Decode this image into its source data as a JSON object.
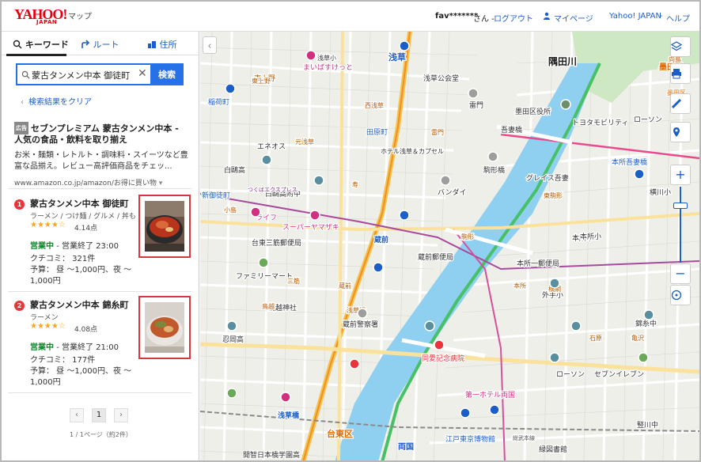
{
  "header": {
    "logo": "YAHOO!",
    "logo_sub": "JAPAN",
    "service": "マップ",
    "user": "fav*******",
    "user_suffix": "さん -",
    "logout": "ログアウト",
    "mypage": "マイページ",
    "yahoo_japan": "Yahoo! JAPAN",
    "help": "ヘルプ"
  },
  "tabs": [
    {
      "label": "キーワード",
      "icon": "search-icon"
    },
    {
      "label": "ルート",
      "icon": "route-arrow-icon"
    },
    {
      "label": "住所",
      "icon": "address-icon"
    }
  ],
  "search": {
    "value": "蒙古タンメン中本 御徒町",
    "button": "検索"
  },
  "back_link": "検索結果をクリア",
  "ad": {
    "badge": "広告",
    "title": "セブンプレミアム 蒙古タンメン中本 - 人気の食品・飲料を取り揃え",
    "desc": "お米・麺類・レトルト・調味料・スイーツなど豊富な品揃え。レビュー高評価商品をチェッ...",
    "url": "www.amazon.co.jp/amazon/お得に買い物"
  },
  "results": [
    {
      "num": "1",
      "name": "蒙古タンメン中本 御徒町",
      "category": "ラーメン / つけ麺 / グルメ / 丼も…",
      "stars": "★★★★☆",
      "score": "4.14点",
      "status_open": "営業中",
      "status_rest": "- 営業終了 23:00",
      "review": "クチコミ： 321件",
      "budget": "予算： 昼 〜1,000円、夜 〜1,000円"
    },
    {
      "num": "2",
      "name": "蒙古タンメン中本 錦糸町",
      "category": "ラーメン",
      "stars": "★★★★☆",
      "score": "4.08点",
      "status_open": "営業中",
      "status_rest": "- 営業終了 21:00",
      "review": "クチコミ： 177件",
      "budget": "予算： 昼 〜1,000円、夜 〜1,000円"
    }
  ],
  "pager": {
    "prev": "‹",
    "current": "1",
    "next": "›",
    "info": "1 / 1ページ（約2件）"
  },
  "map": {
    "labels": [
      {
        "t": "浅草",
        "c": "#1c5ec8"
      },
      {
        "t": "隅田川",
        "c": "#1a1a1a"
      },
      {
        "t": "墨田区",
        "c": "#e06a00"
      },
      {
        "t": "まいばすけっと",
        "c": "#d12f80"
      },
      {
        "t": "東上野",
        "c": "#b85a00"
      },
      {
        "t": "稲荷町",
        "c": "#1c5ec8"
      },
      {
        "t": "浅草公会堂",
        "c": "#333"
      },
      {
        "t": "雷門",
        "c": "#333"
      },
      {
        "t": "墨田区役所",
        "c": "#333"
      },
      {
        "t": "トヨタモビリティ",
        "c": "#333"
      },
      {
        "t": "吾妻橋",
        "c": "#333"
      },
      {
        "t": "田原町",
        "c": "#1c5ec8"
      },
      {
        "t": "エネオス",
        "c": "#333"
      },
      {
        "t": "ホテル浅草＆カプセル",
        "c": "#333"
      },
      {
        "t": "白鷗高",
        "c": "#333"
      },
      {
        "t": "白鷗高附中",
        "c": "#333"
      },
      {
        "t": "バンダイ",
        "c": "#333"
      },
      {
        "t": "駒形橋",
        "c": "#333"
      },
      {
        "t": "グレイス吾妻",
        "c": "#333"
      },
      {
        "t": "本所吾妻橋",
        "c": "#1c5ec8"
      },
      {
        "t": "新御徒町",
        "c": "#1c5ec8"
      },
      {
        "t": "ライフ",
        "c": "#d12f80"
      },
      {
        "t": "スーパーヤマザキ",
        "c": "#d12f80"
      },
      {
        "t": "台東三筋郵便局",
        "c": "#333"
      },
      {
        "t": "蔵前",
        "c": "#1c5ec8"
      },
      {
        "t": "蔵前郵便局",
        "c": "#333"
      },
      {
        "t": "本所中",
        "c": "#333"
      },
      {
        "t": "本所一郵便局",
        "c": "#333"
      },
      {
        "t": "ファミリーマート",
        "c": "#333"
      },
      {
        "t": "外手小",
        "c": "#333"
      },
      {
        "t": "鳥越神社",
        "c": "#333"
      },
      {
        "t": "蔵前警察署",
        "c": "#333"
      },
      {
        "t": "忍岡高",
        "c": "#333"
      },
      {
        "t": "同愛記念病院",
        "c": "#d9363e"
      },
      {
        "t": "ローソン",
        "c": "#333"
      },
      {
        "t": "セブンイレブン",
        "c": "#333"
      },
      {
        "t": "第一ホテル両国",
        "c": "#d12f80"
      },
      {
        "t": "浅草橋",
        "c": "#1c5ec8"
      },
      {
        "t": "両国",
        "c": "#1c5ec8"
      },
      {
        "t": "台東区",
        "c": "#e06a00"
      },
      {
        "t": "江戸東京博物館",
        "c": "#1c5ec8"
      },
      {
        "t": "緑図書館",
        "c": "#333"
      },
      {
        "t": "開智日本橋学園高",
        "c": "#333"
      },
      {
        "t": "錦糸中",
        "c": "#333"
      },
      {
        "t": "竪川中",
        "c": "#333"
      },
      {
        "t": "横川小",
        "c": "#333"
      },
      {
        "t": "本所小",
        "c": "#333"
      },
      {
        "t": "ローソン",
        "c": "#333"
      },
      {
        "t": "向島",
        "c": "#b85a00"
      },
      {
        "t": "石原",
        "c": "#b85a00"
      },
      {
        "t": "駒形",
        "c": "#b85a00"
      },
      {
        "t": "西浅草",
        "c": "#b85a00"
      },
      {
        "t": "雷門",
        "c": "#b85a00"
      },
      {
        "t": "元浅草",
        "c": "#b85a00"
      },
      {
        "t": "寿",
        "c": "#b85a00"
      },
      {
        "t": "蔵前",
        "c": "#b85a00"
      },
      {
        "t": "三筋",
        "c": "#b85a00"
      },
      {
        "t": "小島",
        "c": "#b85a00"
      },
      {
        "t": "鳥越",
        "c": "#b85a00"
      },
      {
        "t": "浅草橋",
        "c": "#b85a00"
      },
      {
        "t": "本所",
        "c": "#b85a00"
      },
      {
        "t": "東駒形",
        "c": "#b85a00"
      },
      {
        "t": "横網",
        "c": "#b85a00"
      },
      {
        "t": "亀沢",
        "c": "#b85a00"
      },
      {
        "t": "つくばエクスプレス",
        "c": "#8a2d8a"
      },
      {
        "t": "総武本線",
        "c": "#555"
      },
      {
        "t": "東上野",
        "c": "#b85a00"
      },
      {
        "t": "浅草小",
        "c": "#333"
      },
      {
        "t": "浅草",
        "c": "#1c5ec8"
      },
      {
        "t": "墨田区",
        "c": "#e06a00"
      }
    ]
  },
  "map_controls": {
    "layers": "layers-icon",
    "print": "print-icon",
    "measure": "ruler-icon",
    "location": "location-pin-icon",
    "zoom_in": "+",
    "zoom_out": "−",
    "collapse": "‹"
  }
}
